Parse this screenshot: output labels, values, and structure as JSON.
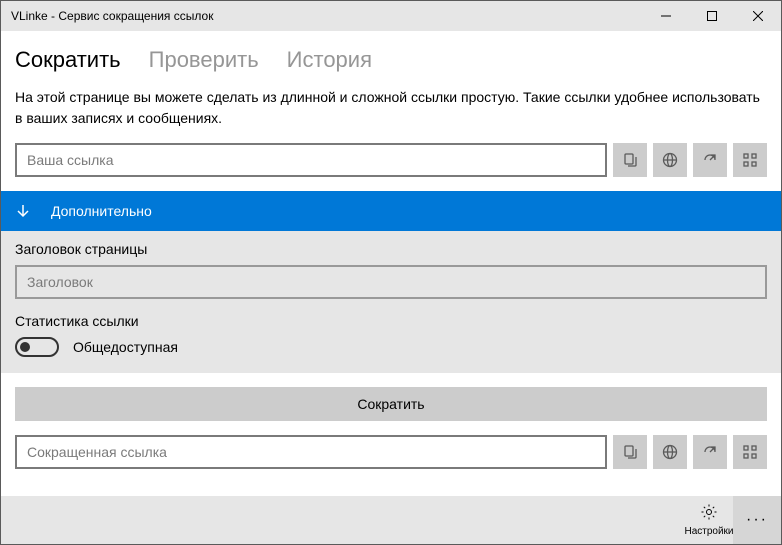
{
  "titlebar": {
    "title": "VLinke - Сервис сокращения ссылок"
  },
  "tabs": {
    "shorten": "Сократить",
    "check": "Проверить",
    "history": "История"
  },
  "description": "На этой странице вы можете сделать из длинной и сложной ссылки простую. Такие ссылки удобнее использовать в ваших записях и сообщениях.",
  "input": {
    "url_placeholder": "Ваша ссылка",
    "short_placeholder": "Сокращенная ссылка"
  },
  "expander": {
    "label": "Дополнительно"
  },
  "panel": {
    "title_label": "Заголовок страницы",
    "title_placeholder": "Заголовок",
    "stat_label": "Статистика ссылки",
    "toggle_label": "Общедоступная"
  },
  "actions": {
    "shorten_btn": "Сократить"
  },
  "footer": {
    "settings": "Настройки"
  }
}
